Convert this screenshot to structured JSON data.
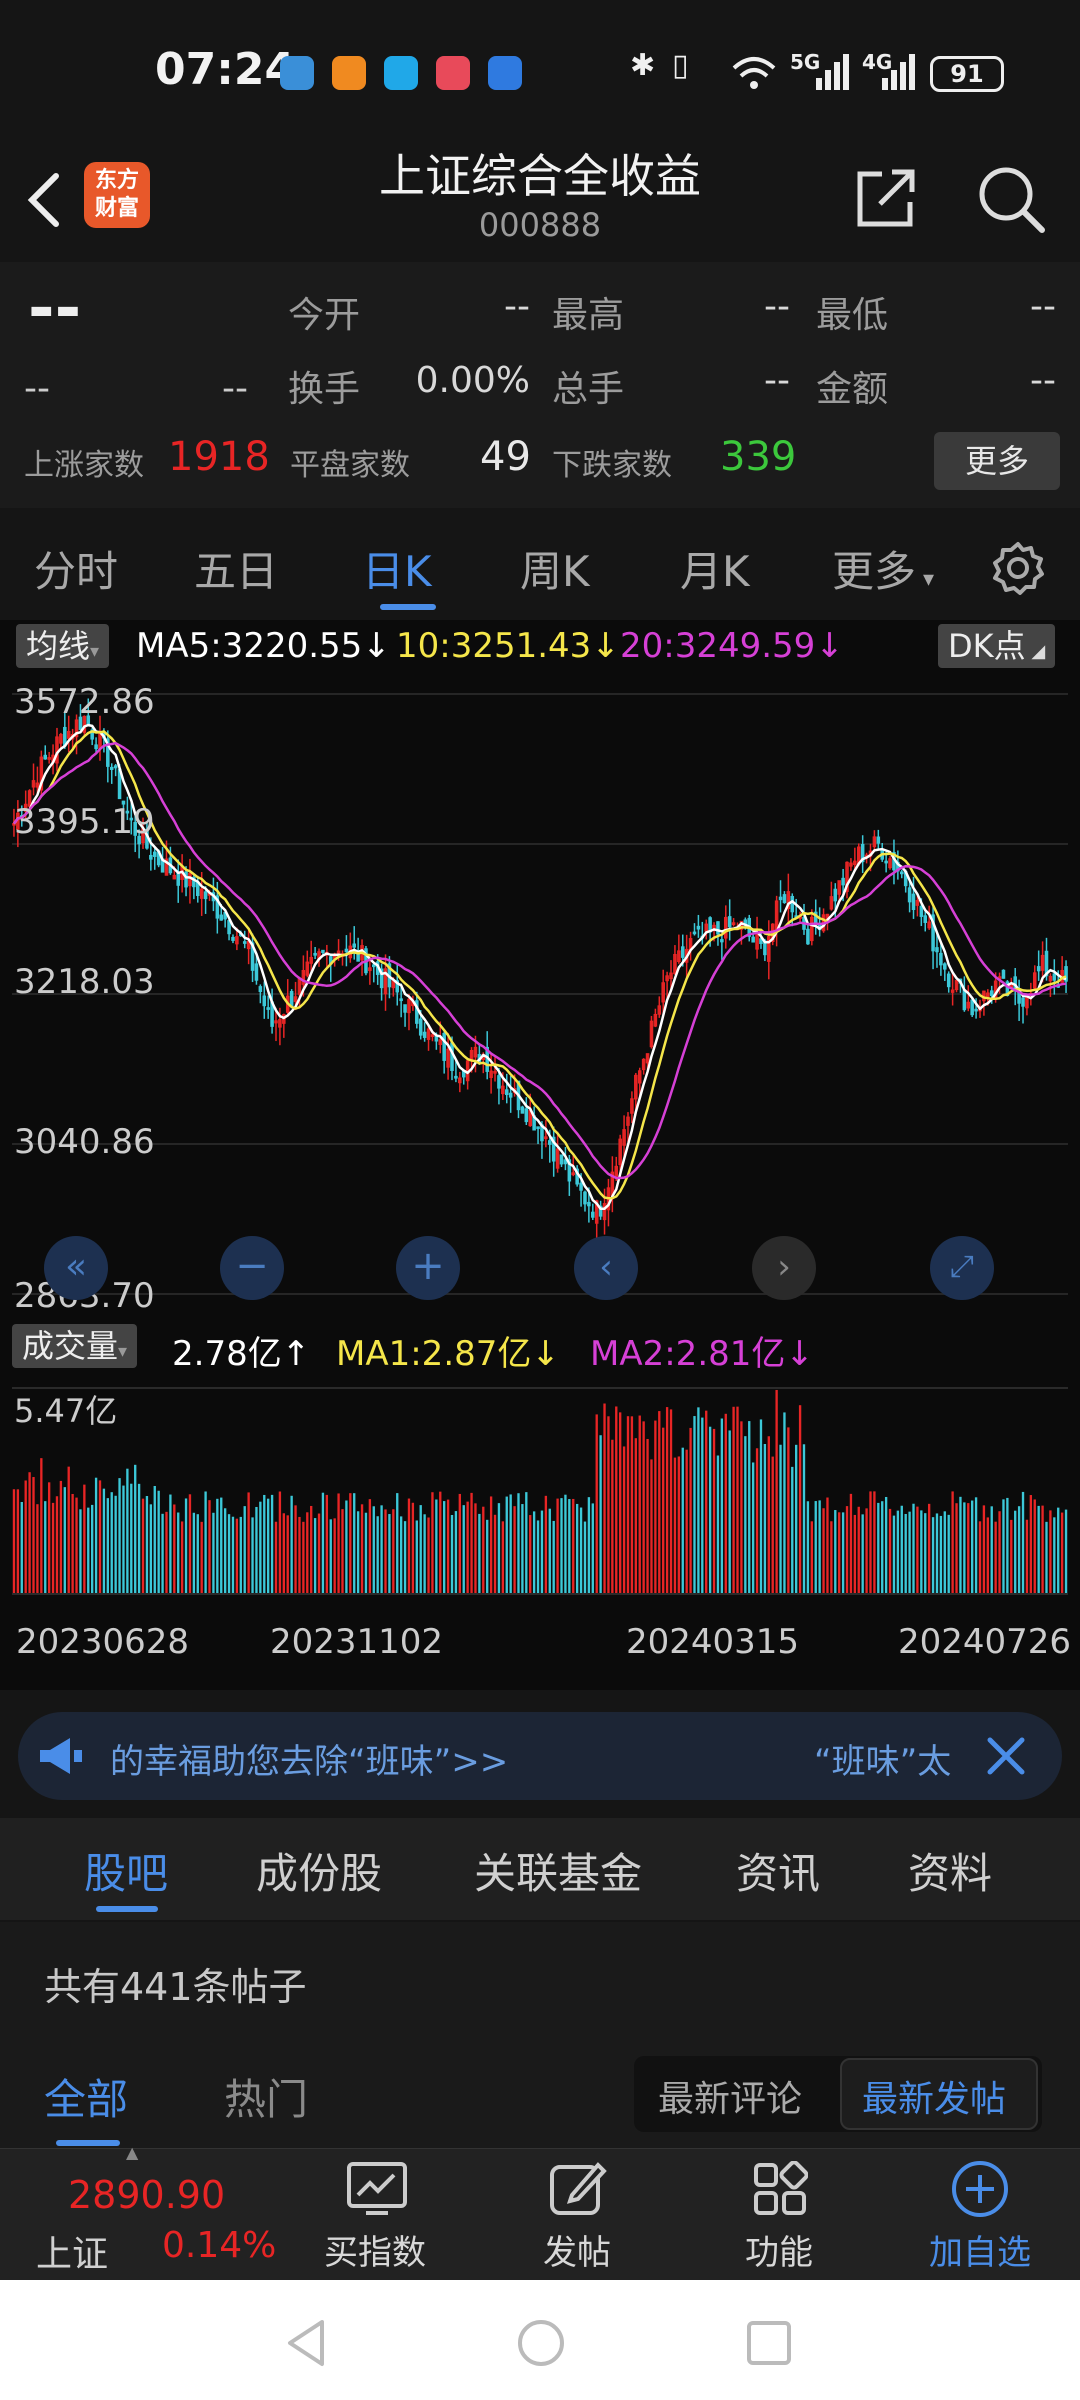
{
  "status": {
    "time": "07:24",
    "network1": "5G",
    "network2": "4G",
    "battery": "91"
  },
  "header": {
    "logo_line1": "东方",
    "logo_line2": "财富",
    "title": "上证综合全收益",
    "code": "000888"
  },
  "quote": {
    "price": "--",
    "change": "--",
    "change_pct": "--",
    "open_label": "今开",
    "open_value": "--",
    "high_label": "最高",
    "high_value": "--",
    "low_label": "最低",
    "low_value": "--",
    "turnover_label": "换手",
    "turnover_value": "0.00%",
    "volume_label": "总手",
    "volume_value": "--",
    "amount_label": "金额",
    "amount_value": "--",
    "up_label": "上涨家数",
    "up_value": "1918",
    "flat_label": "平盘家数",
    "flat_value": "49",
    "down_label": "下跌家数",
    "down_value": "339",
    "more_label": "更多"
  },
  "period_tabs": [
    "分时",
    "五日",
    "日K",
    "周K",
    "月K",
    "更多"
  ],
  "active_period": "日K",
  "chart_header": {
    "ma_tag": "均线",
    "ma5": "MA5:3220.55↓",
    "ma10": "10:3251.43↓",
    "ma20": "20:3249.59↓",
    "dk_tag": "DK点"
  },
  "volume_header": {
    "tag": "成交量",
    "vol": "2.78亿↑",
    "ma1": "MA1:2.87亿↓",
    "ma2": "MA2:2.81亿↓"
  },
  "colors": {
    "up": "#e82525",
    "down": "#3cc8d8",
    "ma5": "#ffffff",
    "ma10": "#f5e64a",
    "ma20": "#d640d6",
    "accent": "#4a8de8",
    "green": "#3cc83c"
  },
  "chart_data": {
    "type": "candlestick",
    "y_ticks": [
      "3572.86",
      "3395.19",
      "3218.03",
      "3040.86",
      "2863.70"
    ],
    "ylim": [
      2863.7,
      3572.86
    ],
    "x_ticks": [
      "20230628",
      "20231102",
      "20240315",
      "20240726"
    ],
    "volume_ticks": [
      "5.47亿"
    ],
    "approx_close_path": [
      3420,
      3480,
      3520,
      3545,
      3500,
      3420,
      3380,
      3360,
      3340,
      3310,
      3270,
      3180,
      3220,
      3260,
      3275,
      3260,
      3230,
      3200,
      3160,
      3130,
      3150,
      3110,
      3080,
      3040,
      2990,
      2960,
      3050,
      3150,
      3240,
      3280,
      3290,
      3300,
      3270,
      3340,
      3290,
      3330,
      3380,
      3395,
      3360,
      3300,
      3240,
      3200,
      3230,
      3210,
      3250,
      3230
    ]
  },
  "ticker": {
    "text1": "的幸福助您去除“班味”>>",
    "text2": "“班味”太"
  },
  "section_tabs": [
    "股吧",
    "成份股",
    "关联基金",
    "资讯",
    "资料"
  ],
  "posts": {
    "count_text": "共有441条帖子",
    "tab_all": "全部",
    "tab_hot": "热门",
    "sort_comment": "最新评论",
    "sort_post": "最新发帖"
  },
  "toolbar": {
    "index_value": "2890.90",
    "index_name": "上证",
    "index_pct": "0.14%",
    "buy_label": "买指数",
    "post_label": "发帖",
    "func_label": "功能",
    "add_label": "加自选"
  }
}
